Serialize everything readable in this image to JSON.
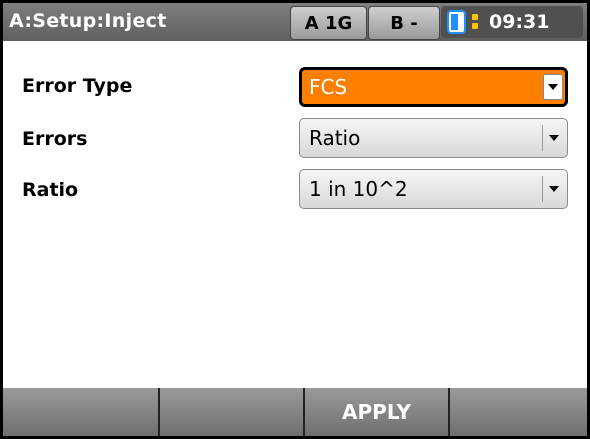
{
  "header": {
    "title": "A:Setup:Inject",
    "tab_a": "A 1G",
    "tab_b": "B -",
    "time": "09:31"
  },
  "form": {
    "rows": [
      {
        "label": "Error Type",
        "value": "FCS"
      },
      {
        "label": "Errors",
        "value": "Ratio"
      },
      {
        "label": "Ratio",
        "value": "1 in 10^2"
      }
    ]
  },
  "softkeys": [
    "",
    "",
    "APPLY",
    ""
  ],
  "colors": {
    "header": "#6f6f6f",
    "active_select": "#ff7f00",
    "battery": "#1e90ff",
    "indicator": "#ffc400"
  }
}
